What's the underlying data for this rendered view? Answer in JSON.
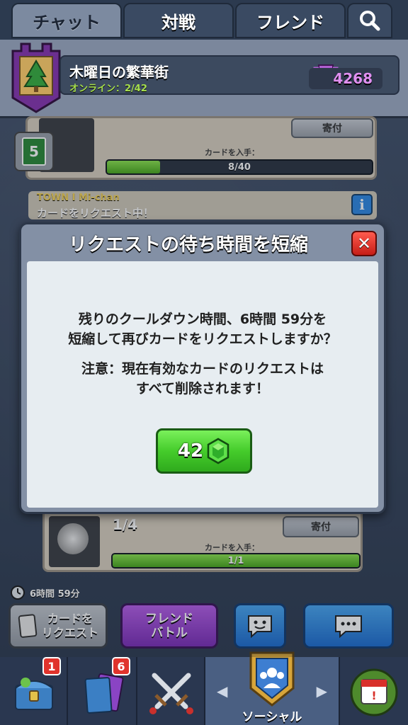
{
  "tabs": [
    "チャット",
    "対戦",
    "フレンド"
  ],
  "clan": {
    "name": "木曜日の繁華街",
    "online": "オンライン：2/42",
    "trophies": "4268",
    "badge_level": "5"
  },
  "card_top": {
    "donate_label": "寄付",
    "request_label": "カードを入手：",
    "progress_text": "8/40",
    "progress_fraction": 0.2
  },
  "request_notice": {
    "sender": "TOWN I Mi-chan",
    "message": "カードをリクエスト中！"
  },
  "card_bottom": {
    "count": "1/4",
    "donate_label": "寄付",
    "request_label": "カードを入手：",
    "progress_text": "1/1",
    "progress_fraction": 1.0
  },
  "modal": {
    "title": "リクエストの待ち時間を短縮",
    "line1": "残りのクールダウン時間、6時間 59分を",
    "line2": "短縮して再びカードをリクエストしますか？",
    "line3": "注意：現在有効なカードのリクエストは",
    "line4": "すべて削除されます！",
    "gem_cost": "42"
  },
  "timer": "6時間 59分",
  "actions": {
    "request_card": "カードを\nリクエスト",
    "friend_battle": "フレンド\nバトル"
  },
  "nav": {
    "chest_badge": "1",
    "cards_badge": "6",
    "social_label": "ソーシャル"
  },
  "colors": {
    "gem_button": "#45cc2b",
    "close_button": "#e0332c",
    "friend_battle": "#9b3fd6",
    "chat_button": "#2e8ee6"
  }
}
